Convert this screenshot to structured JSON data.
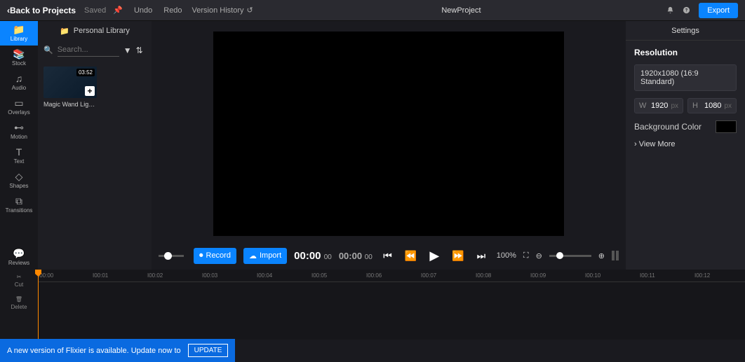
{
  "topbar": {
    "back": "Back to Projects",
    "saved": "Saved",
    "undo": "Undo",
    "redo": "Redo",
    "history": "Version History",
    "project_name": "NewProject",
    "export": "Export"
  },
  "nav": {
    "items": [
      {
        "label": "Library"
      },
      {
        "label": "Stock"
      },
      {
        "label": "Audio"
      },
      {
        "label": "Overlays"
      },
      {
        "label": "Motion"
      },
      {
        "label": "Text"
      },
      {
        "label": "Shapes"
      },
      {
        "label": "Transitions"
      }
    ],
    "reviews": "Reviews"
  },
  "library": {
    "header": "Personal Library",
    "search_placeholder": "Search...",
    "clip": {
      "duration": "03:52",
      "title": "Magic Wand Light..."
    }
  },
  "player": {
    "record": "Record",
    "import": "Import",
    "time1": "00:00",
    "time1_ms": "00",
    "time2": "00:00",
    "time2_ms": "00",
    "zoom_pct": "100%"
  },
  "settings": {
    "header": "Settings",
    "resolution_label": "Resolution",
    "resolution_value": "1920x1080 (16:9 Standard)",
    "w_label": "W",
    "w_value": "1920",
    "w_unit": "px",
    "h_label": "H",
    "h_value": "1080",
    "h_unit": "px",
    "bg_label": "Background Color",
    "viewmore": "View More"
  },
  "timeline": {
    "tools": [
      {
        "label": "Cut"
      },
      {
        "label": "Delete"
      }
    ],
    "ticks": [
      "I00:00",
      "I00:01",
      "I00:02",
      "I00:03",
      "I00:04",
      "I00:05",
      "I00:06",
      "I00:07",
      "I00:08",
      "I00:09",
      "I00:10",
      "I00:11",
      "I00:12"
    ]
  },
  "banner": {
    "text": "A new version of Flixier is available. Update now to",
    "button": "UPDATE"
  }
}
